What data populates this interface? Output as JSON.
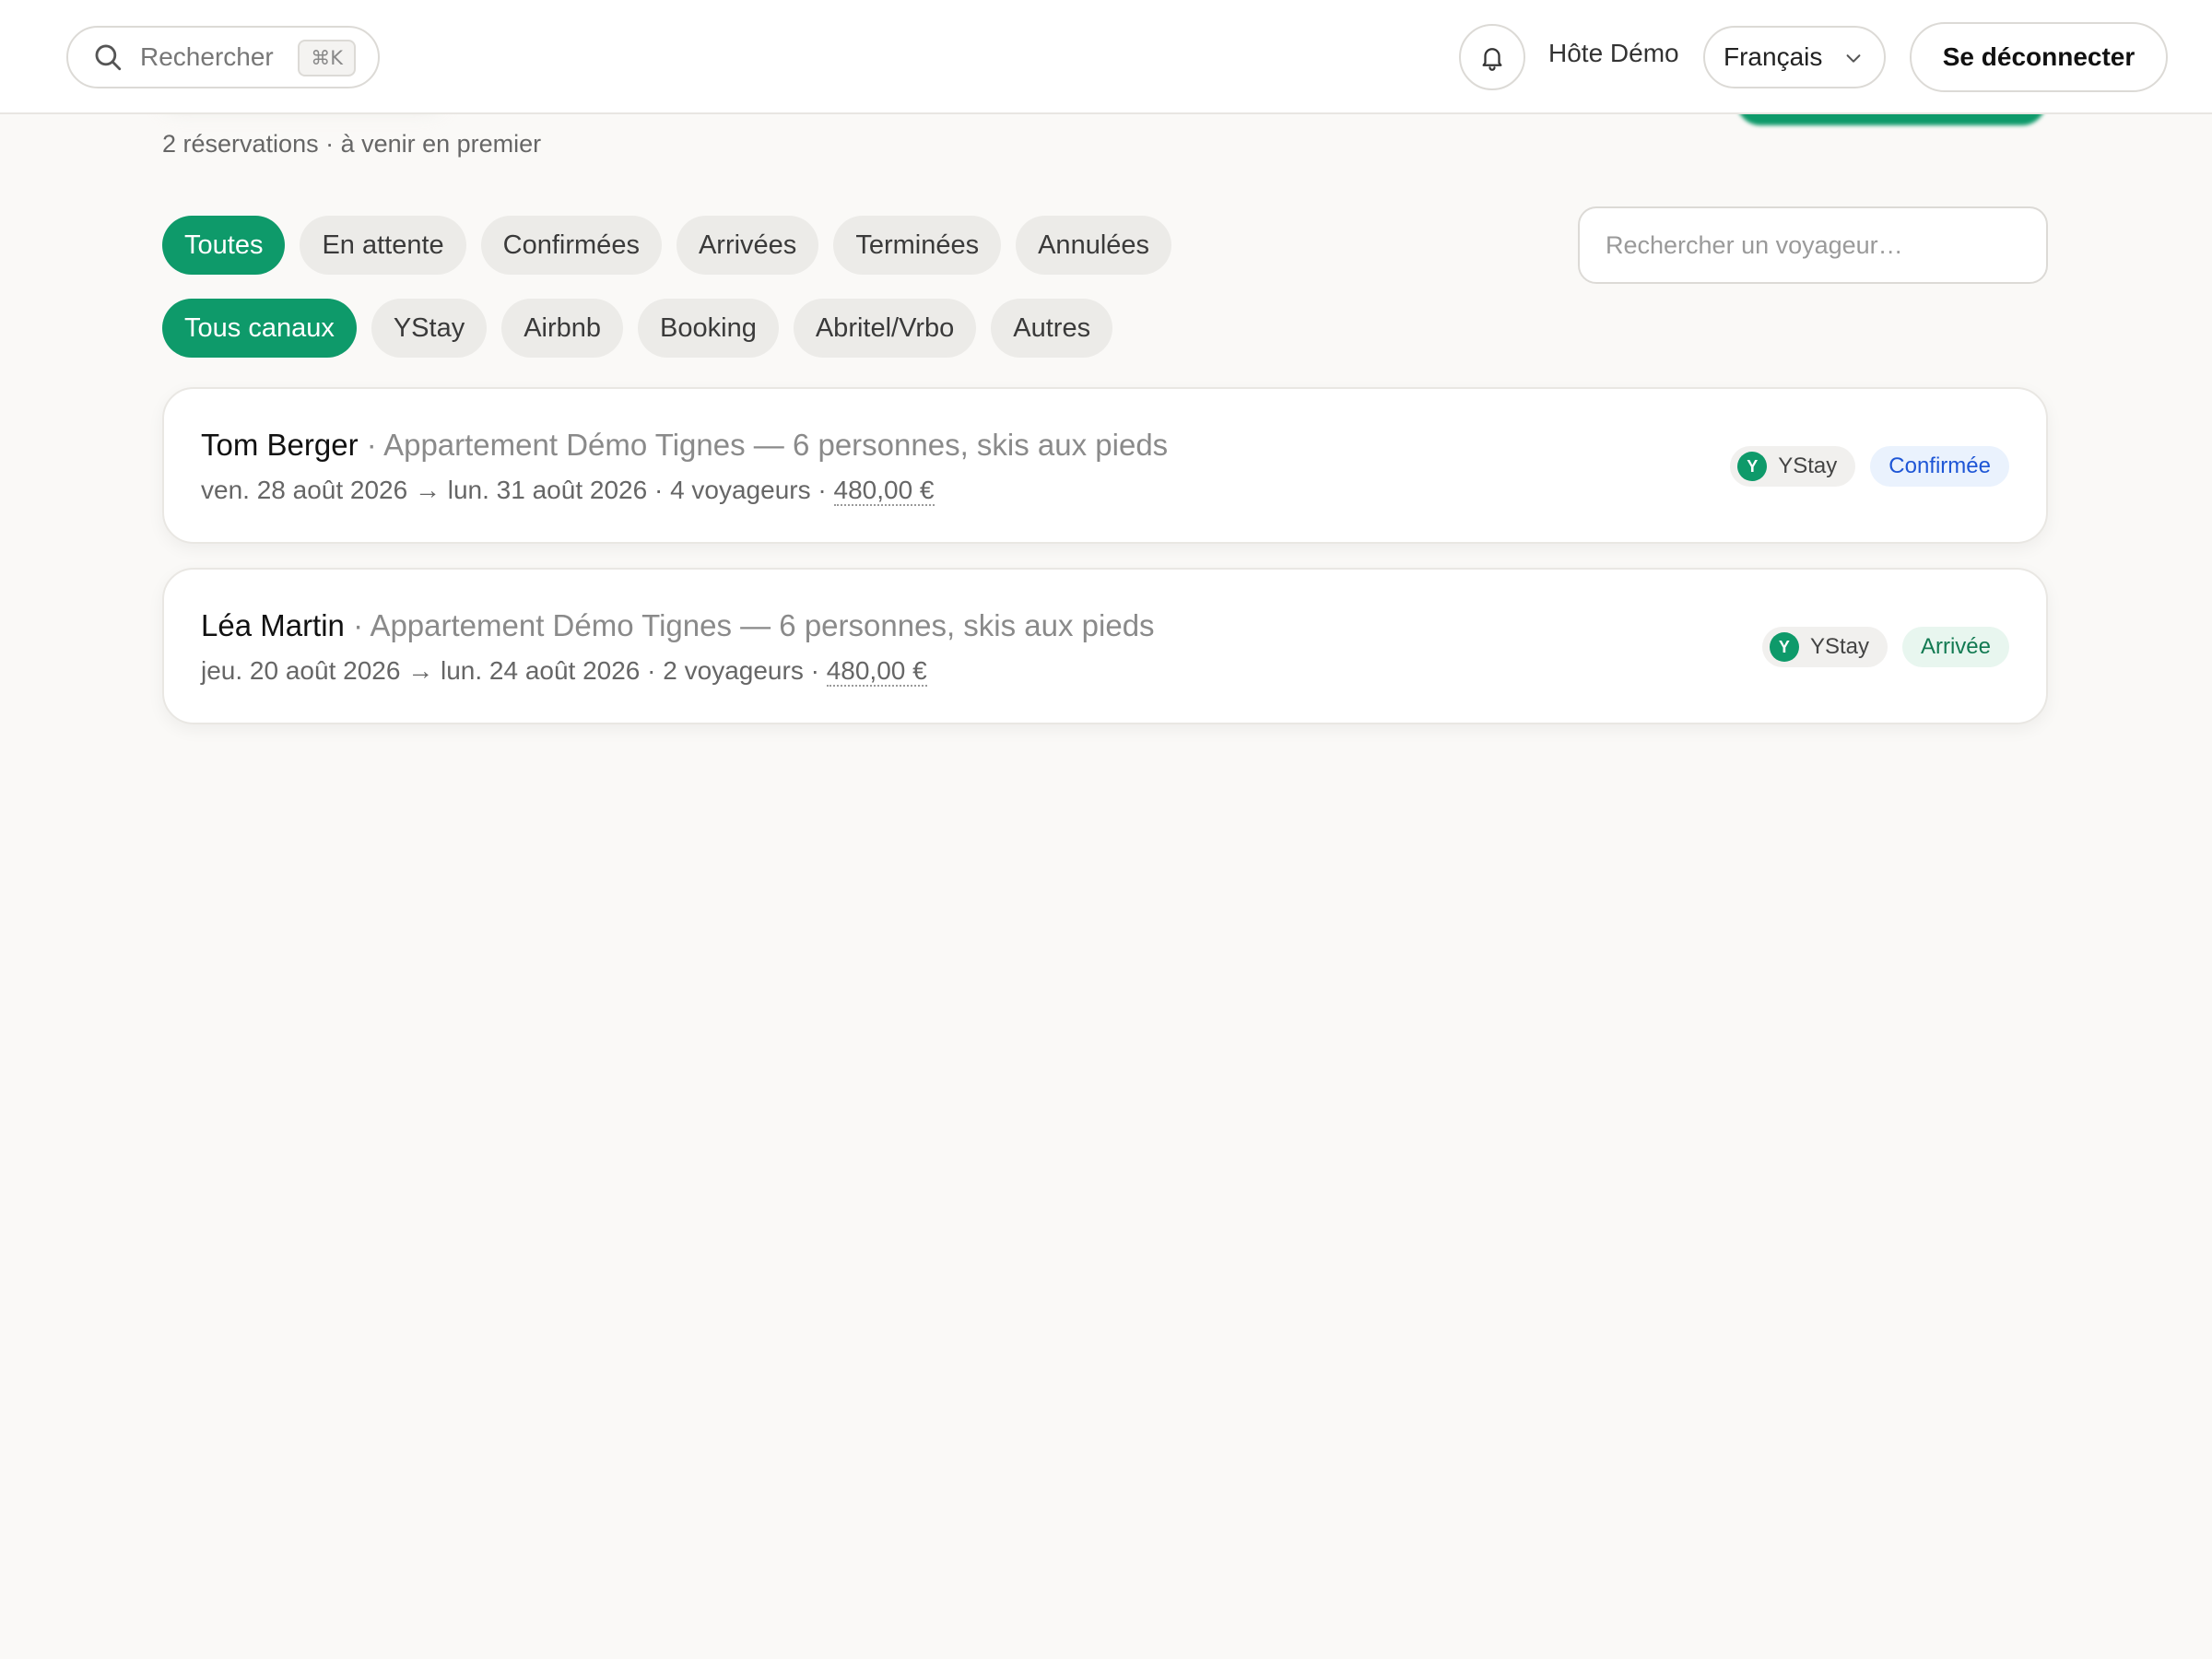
{
  "header": {
    "search_placeholder": "Rechercher",
    "search_shortcut": "⌘K",
    "host_name": "Hôte Démo",
    "language": "Français",
    "logout_label": "Se déconnecter"
  },
  "page": {
    "subtitle": "2 réservations · à venir en premier"
  },
  "status_filters": [
    "Toutes",
    "En attente",
    "Confirmées",
    "Arrivées",
    "Terminées",
    "Annulées"
  ],
  "channel_filters": [
    "Tous canaux",
    "YStay",
    "Airbnb",
    "Booking",
    "Abritel/Vrbo",
    "Autres"
  ],
  "traveler_search_placeholder": "Rechercher un voyageur…",
  "reservations": [
    {
      "guest": "Tom Berger",
      "property": "Appartement Démo Tignes — 6 personnes, skis aux pieds",
      "dates": "ven. 28 août 2026 → lun. 31 août 2026",
      "travelers": "4 voyageurs",
      "price": "480,00 €",
      "channel": "YStay",
      "channel_initial": "Y",
      "status": "Confirmée"
    },
    {
      "guest": "Léa Martin",
      "property": "Appartement Démo Tignes — 6 personnes, skis aux pieds",
      "dates": "jeu. 20 août 2026 → lun. 24 août 2026",
      "travelers": "2 voyageurs",
      "price": "480,00 €",
      "channel": "YStay",
      "channel_initial": "Y",
      "status": "Arrivée"
    }
  ],
  "icons": {
    "search": "search-icon",
    "bell": "bell-icon",
    "chevron": "chevron-down-icon"
  },
  "colors": {
    "accent": "#0e9a6a",
    "confirmed": "#1e56d6",
    "arrived": "#127a52",
    "background": "#faf9f7"
  }
}
